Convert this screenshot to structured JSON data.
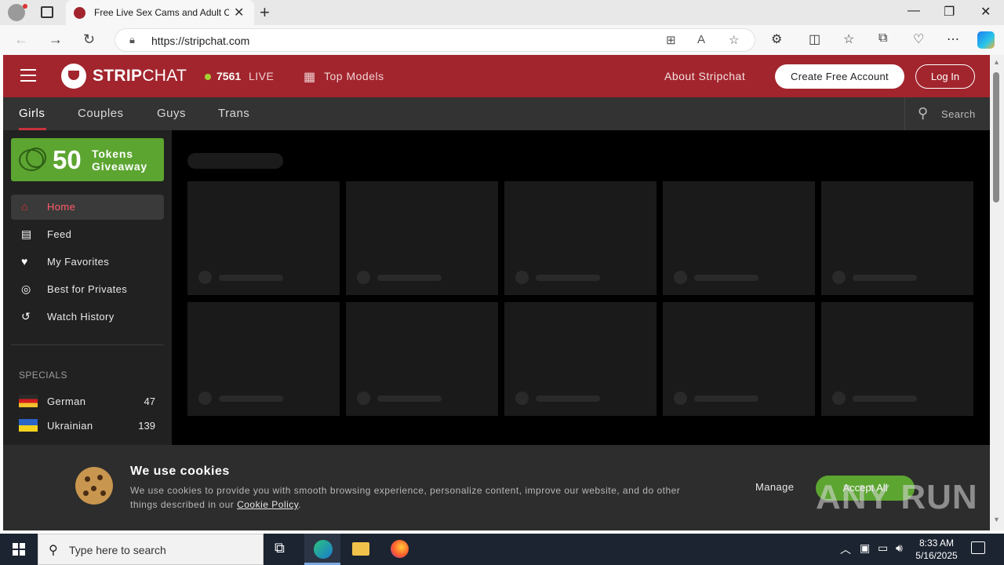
{
  "browser": {
    "tab_title": "Free Live Sex Cams and Adult Chat",
    "tab_close": "✕",
    "new_tab": "+",
    "url": "https://stripchat.com",
    "win_min": "—",
    "win_restore": "❐",
    "win_close": "✕"
  },
  "header": {
    "logo_strip": "STRIP",
    "logo_chat": "CHAT",
    "live_count": "7561",
    "live_label": "LIVE",
    "top_models": "Top Models",
    "about": "About Stripchat",
    "create_account": "Create Free Account",
    "login": "Log In"
  },
  "subnav": {
    "items": [
      "Girls",
      "Couples",
      "Guys",
      "Trans"
    ],
    "search": "Search"
  },
  "sidebar": {
    "giveaway_number": "50",
    "giveaway_text": "Tokens Giveaway",
    "menu": [
      {
        "label": "Home",
        "icon": "home-icon"
      },
      {
        "label": "Feed",
        "icon": "feed-icon"
      },
      {
        "label": "My Favorites",
        "icon": "heart-icon"
      },
      {
        "label": "Best for Privates",
        "icon": "privates-icon"
      },
      {
        "label": "Watch History",
        "icon": "history-icon"
      }
    ],
    "specials_heading": "SPECIALS",
    "specials": [
      {
        "label": "German",
        "count": "47"
      },
      {
        "label": "Ukrainian",
        "count": "139"
      }
    ]
  },
  "cookie_banner": {
    "title": "We use cookies",
    "text": "We use cookies to provide you with smooth browsing experience, personalize content, improve our website, and do other things described in our",
    "link": "Cookie Policy",
    "text_end": ".",
    "manage": "Manage",
    "accept": "Accept All",
    "watermark": "ANY RUN"
  },
  "taskbar": {
    "search_placeholder": "Type here to search",
    "time": "8:33 AM",
    "date": "5/16/2025"
  },
  "colors": {
    "brand_red": "#a2252d",
    "accent_green": "#5ca531",
    "live_green": "#a4d233"
  }
}
